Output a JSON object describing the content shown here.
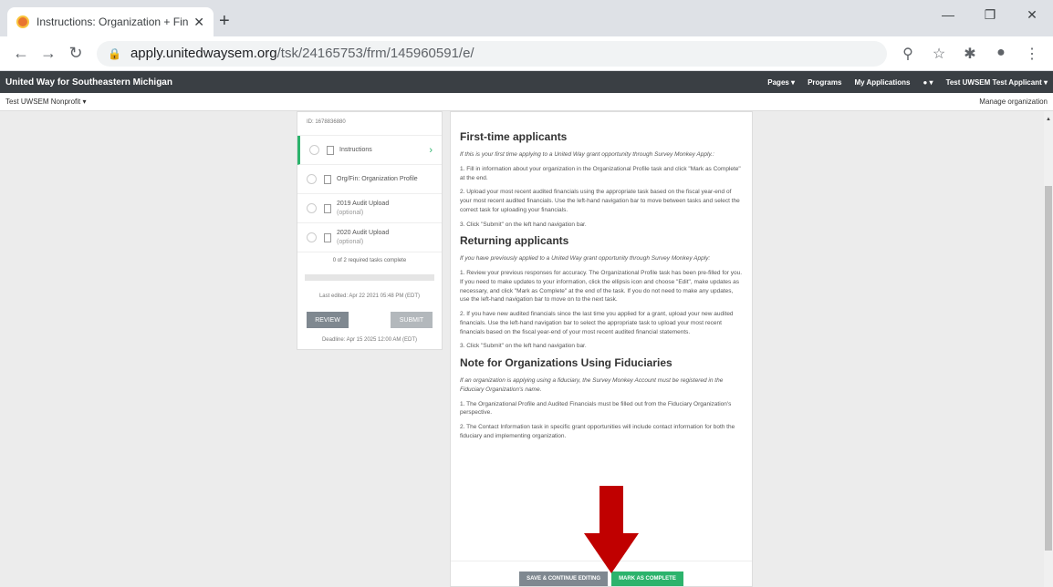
{
  "browser": {
    "tab_title": "Instructions: Organization + Fina",
    "url_host": "apply.unitedwaysem.org",
    "url_path": "/tsk/24165753/frm/145960591/e/"
  },
  "appbar": {
    "brand": "United Way for Southeastern Michigan",
    "menu": [
      "Pages ▾",
      "Programs",
      "My Applications",
      "●  ▾",
      "Test UWSEM Test Applicant ▾"
    ]
  },
  "subbar": {
    "org": "Test UWSEM Nonprofit ▾",
    "manage": "Manage organization"
  },
  "leftpanel": {
    "id": "ID: 1678836880",
    "tasks": [
      {
        "label": "Instructions",
        "optional": ""
      },
      {
        "label": "Org/Fin: Organization Profile",
        "optional": ""
      },
      {
        "label": "2019 Audit Upload",
        "optional": "(optional)"
      },
      {
        "label": "2020 Audit Upload",
        "optional": "(optional)"
      }
    ],
    "progress": "0 of 2 required tasks complete",
    "last_edited": "Last edited: Apr 22 2021 05:48 PM (EDT)",
    "review": "REVIEW",
    "submit": "SUBMIT",
    "deadline": "Deadline: Apr 15 2025 12:00 AM (EDT)"
  },
  "main": {
    "h1": "First-time applicants",
    "p1": "If this is your first time applying to a United Way grant opportunity through Survey Monkey Apply.:",
    "p2": "1. Fill in information about your organization in the Organizational Profile task and click \"Mark as Complete\" at the end.",
    "p3": "2. Upload your most recent audited financials using the appropriate task based on the fiscal year-end of your most recent audited financials.  Use the left-hand navigation bar to move between tasks and select the correct task for uploading your financials.",
    "p4": "3. Click \"Submit\" on the left hand navigation bar.",
    "h2": "Returning applicants",
    "p5": "If you have previously applied to a United Way grant opportunity through Survey Monkey Apply:",
    "p6": "1. Review your previous responses for accuracy.  The Organizational Profile task has been pre-filled for you.  If you need to make updates to your information, click the ellipsis icon and choose \"Edit\", make updates as necessary, and click \"Mark as Complete\" at the end of the task.  If you do not need to make any updates, use the left-hand navigation bar to move on to the next task.",
    "p7": "2. If you have new audited financials since the last time you applied for a grant, upload your new audited financials. Use the left-hand navigation bar to select the appropriate task to upload your most recent financials based on the fiscal year-end of your most recent audited financial statements.",
    "p8": "3. Click \"Submit\" on the left hand navigation bar.",
    "h3": "Note for Organizations Using Fiduciaries",
    "p9": "If an organization is applying using a fiduciary, the Survey Monkey Account must be registered in the Fiduciary Organization's name.",
    "p10": "1. The Organizational Profile and Audited Financials must be filled out from the Fiduciary Organization's perspective.",
    "p11": "2. The Contact Information task in specific grant opportunities will include contact information for both the fiduciary and implementing organization.",
    "save_btn": "SAVE & CONTINUE EDITING",
    "mark_btn": "MARK AS COMPLETE"
  }
}
